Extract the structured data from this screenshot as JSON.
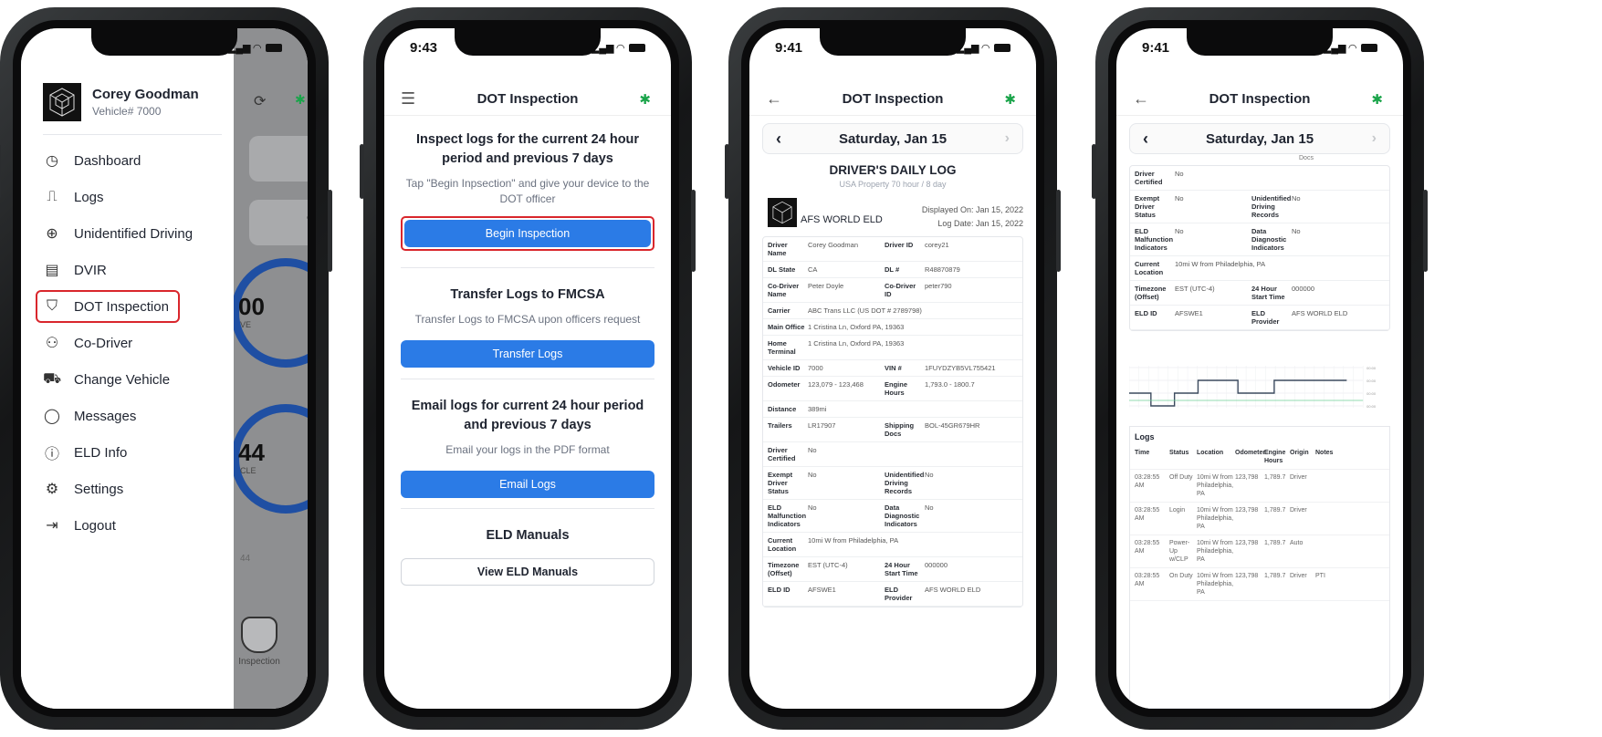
{
  "phone1": {
    "time": "",
    "user": {
      "name": "Corey Goodman",
      "vehicle": "Vehicle# 7000"
    },
    "menu": [
      {
        "label": "Dashboard",
        "icon": "clock-icon"
      },
      {
        "label": "Logs",
        "icon": "logs-icon"
      },
      {
        "label": "Unidentified Driving",
        "icon": "search-icon"
      },
      {
        "label": "DVIR",
        "icon": "clipboard-icon"
      },
      {
        "label": "DOT Inspection",
        "icon": "shield-icon"
      },
      {
        "label": "Co-Driver",
        "icon": "users-icon"
      },
      {
        "label": "Change Vehicle",
        "icon": "truck-icon"
      },
      {
        "label": "Messages",
        "icon": "chat-icon"
      },
      {
        "label": "ELD Info",
        "icon": "info-icon"
      },
      {
        "label": "Settings",
        "icon": "gear-icon"
      },
      {
        "label": "Logout",
        "icon": "logout-icon"
      }
    ],
    "bg": {
      "ring1": "00",
      "ring1_sub": "VE",
      "ring2": "44",
      "ring2_sub": "CLE",
      "small": "44",
      "tab": "Inspection"
    }
  },
  "phone2": {
    "time": "9:43",
    "header": "DOT Inspection",
    "inspect": {
      "title": "Inspect logs for the current 24 hour period and previous 7 days",
      "sub": "Tap \"Begin Inpsection\" and give your device to the DOT officer",
      "button": "Begin Inspection"
    },
    "transfer": {
      "title": "Transfer Logs to FMCSA",
      "sub": "Transfer Logs to FMCSA upon officers request",
      "button": "Transfer Logs"
    },
    "email": {
      "title": "Email logs for current 24 hour period and previous 7 days",
      "sub": "Email your logs in the PDF format",
      "button": "Email Logs"
    },
    "manuals": {
      "title": "ELD Manuals",
      "button": "View ELD Manuals"
    }
  },
  "phone3": {
    "time": "9:41",
    "header": "DOT Inspection",
    "date": "Saturday, Jan 15",
    "log_title": "DRIVER'S DAILY LOG",
    "log_sub": "USA Property 70 hour / 8 day",
    "provider": "AFS WORLD ELD",
    "displayed_on": "Displayed On: Jan 15, 2022",
    "log_date": "Log Date: Jan 15, 2022",
    "rows": [
      {
        "k": "Driver Name",
        "v": "Corey Goodman",
        "k2": "Driver ID",
        "v2": "corey21"
      },
      {
        "k": "DL State",
        "v": "CA",
        "k2": "DL #",
        "v2": "R48870879"
      },
      {
        "k": "Co-Driver Name",
        "v": "Peter Doyle",
        "k2": "Co-Driver ID",
        "v2": "peter790"
      },
      {
        "k": "Carrier",
        "v": "ABC Trans LLC (US DOT # 2789798)",
        "k2": "",
        "v2": ""
      },
      {
        "k": "Main Office",
        "v": "1 Cristina Ln, Oxford PA, 19363",
        "k2": "",
        "v2": ""
      },
      {
        "k": "Home Terminal",
        "v": "1 Cristina Ln, Oxford PA, 19363",
        "k2": "",
        "v2": ""
      },
      {
        "k": "Vehicle ID",
        "v": "7000",
        "k2": "VIN #",
        "v2": "1FUYDZYB5VL755421"
      },
      {
        "k": "Odometer",
        "v": "123,079 - 123,468",
        "k2": "Engine Hours",
        "v2": "1,793.0 - 1800.7"
      },
      {
        "k": "Distance",
        "v": "389mi",
        "k2": "",
        "v2": ""
      },
      {
        "k": "Trailers",
        "v": "LR17907",
        "k2": "Shipping Docs",
        "v2": "BOL-45GR679HR"
      },
      {
        "k": "Driver Certified",
        "v": "No",
        "k2": "",
        "v2": ""
      },
      {
        "k": "Exempt Driver Status",
        "v": "No",
        "k2": "Unidentified Driving Records",
        "v2": "No"
      },
      {
        "k": "ELD Malfunction Indicators",
        "v": "No",
        "k2": "Data Diagnostic Indicators",
        "v2": "No"
      },
      {
        "k": "Current Location",
        "v": "10mi W from Philadelphia, PA",
        "k2": "",
        "v2": ""
      },
      {
        "k": "Timezone (Offset)",
        "v": "EST (UTC-4)",
        "k2": "24 Hour Start Time",
        "v2": "000000"
      },
      {
        "k": "ELD ID",
        "v": "AFSWE1",
        "k2": "ELD Provider",
        "v2": "AFS WORLD ELD"
      }
    ]
  },
  "phone4": {
    "time": "9:41",
    "header": "DOT Inspection",
    "date": "Saturday, Jan 15",
    "partial": "Docs",
    "rows": [
      {
        "k": "Driver Certified",
        "v": "No",
        "k2": "",
        "v2": ""
      },
      {
        "k": "Exempt Driver Status",
        "v": "No",
        "k2": "Unidentified Driving Records",
        "v2": "No"
      },
      {
        "k": "ELD Malfunction Indicators",
        "v": "No",
        "k2": "Data Diagnostic Indicators",
        "v2": "No"
      },
      {
        "k": "Current Location",
        "v": "10mi W from Philadelphia, PA",
        "k2": "",
        "v2": ""
      },
      {
        "k": "Timezone (Offset)",
        "v": "EST (UTC-4)",
        "k2": "24 Hour Start Time",
        "v2": "000000"
      },
      {
        "k": "ELD ID",
        "v": "AFSWE1",
        "k2": "ELD Provider",
        "v2": "AFS WORLD ELD"
      }
    ],
    "logs_title": "Logs",
    "log_headers": [
      "Time",
      "Status",
      "Location",
      "Odometer",
      "Engine Hours",
      "Origin",
      "Notes"
    ],
    "logs": [
      [
        "03:28:55 AM",
        "Off Duty",
        "10mi W from Philadelphia, PA",
        "123,798",
        "1,789.7",
        "Driver",
        ""
      ],
      [
        "03:28:55 AM",
        "Login",
        "10mi W from Philadelphia, PA",
        "123,798",
        "1,789.7",
        "Driver",
        ""
      ],
      [
        "03:28:55 AM",
        "Power-Up w/CLP",
        "10mi W from Philadelphia, PA",
        "123,798",
        "1,789.7",
        "Auto",
        ""
      ],
      [
        "03:28:55 AM",
        "On Duty",
        "10mi W from Philadelphia, PA",
        "123,798",
        "1,789.7",
        "Driver",
        "PTI"
      ]
    ]
  },
  "colors": {
    "accent": "#2b7be6",
    "highlight": "#d9262c",
    "bluetooth": "#1aa44a",
    "ring": "#1f4fa3"
  }
}
